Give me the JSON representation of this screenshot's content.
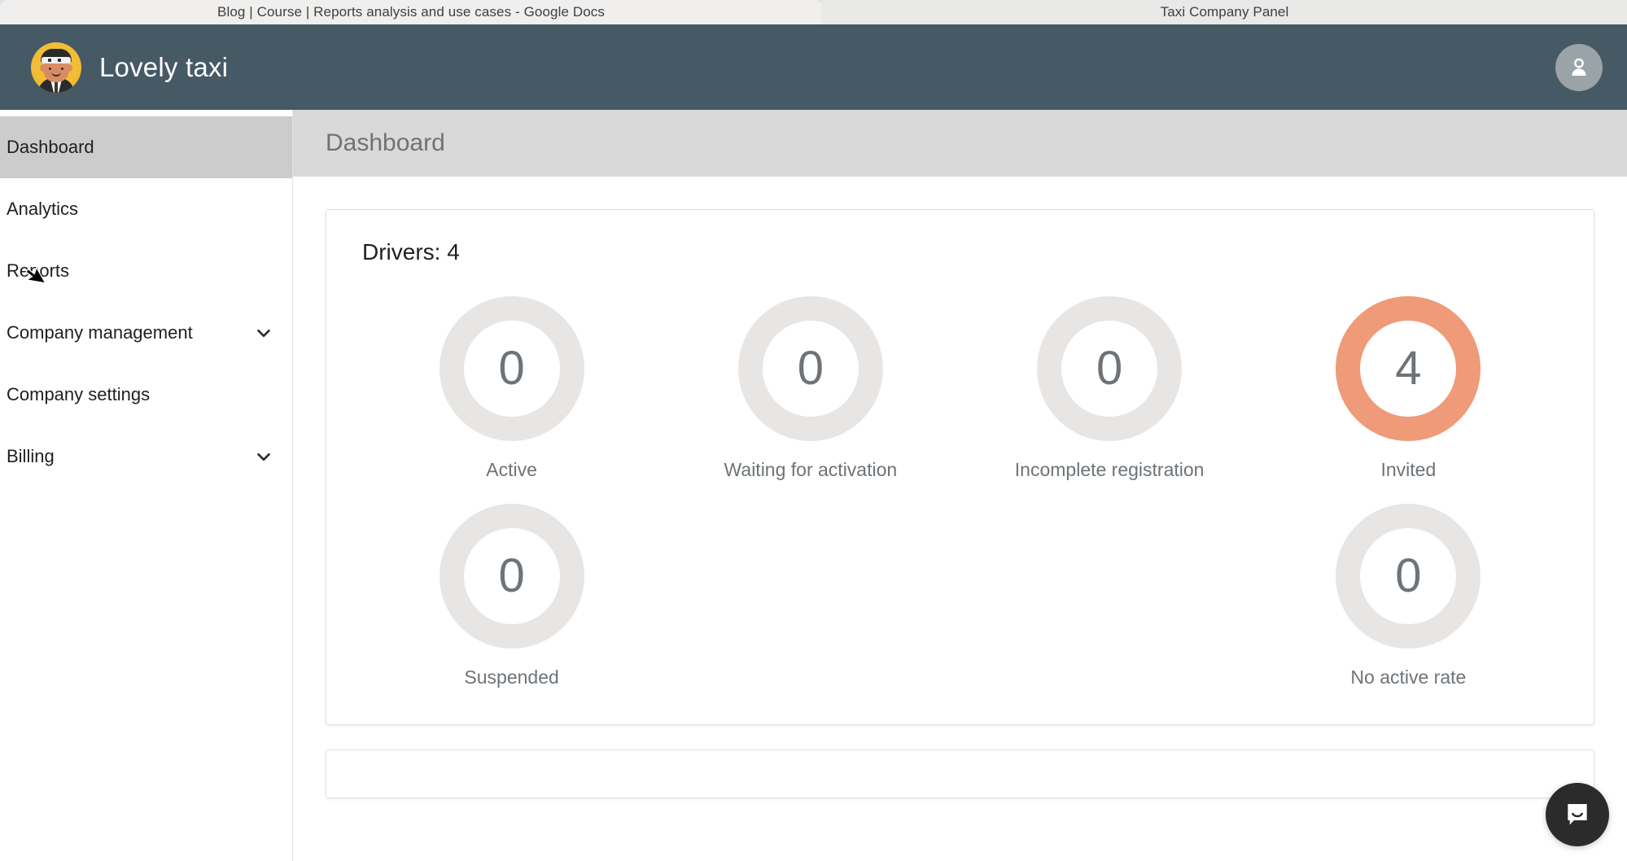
{
  "browser": {
    "tabs": [
      {
        "title": "Blog | Course | Reports analysis and use cases - Google Docs",
        "active": true
      },
      {
        "title": "Taxi Company Panel",
        "active": false
      }
    ]
  },
  "topbar": {
    "logo_icon": "taxi-driver-avatar-icon",
    "brand_name": "Lovely taxi",
    "profile_icon": "person-icon"
  },
  "sidebar": {
    "items": [
      {
        "label": "Dashboard",
        "selected": true,
        "chevron": false
      },
      {
        "label": "Analytics",
        "selected": false,
        "chevron": false
      },
      {
        "label": "Reports",
        "selected": false,
        "chevron": false
      },
      {
        "label": "Company management",
        "selected": false,
        "chevron": true
      },
      {
        "label": "Company settings",
        "selected": false,
        "chevron": false
      },
      {
        "label": "Billing",
        "selected": false,
        "chevron": true
      }
    ],
    "chevron_icon": "chevron-down-icon"
  },
  "page": {
    "title": "Dashboard"
  },
  "drivers_card": {
    "title": "Drivers: 4",
    "stats": [
      {
        "value": "0",
        "label": "Active",
        "color": "#e8e6e4"
      },
      {
        "value": "0",
        "label": "Waiting for activation",
        "color": "#e8e6e4"
      },
      {
        "value": "0",
        "label": "Incomplete registration",
        "color": "#e8e6e4"
      },
      {
        "value": "4",
        "label": "Invited",
        "color": "#ef9a78"
      },
      {
        "value": "0",
        "label": "Suspended",
        "color": "#e8e6e4"
      },
      {
        "value": "",
        "label": "",
        "color": "none"
      },
      {
        "value": "",
        "label": "",
        "color": "none"
      },
      {
        "value": "0",
        "label": "No active rate",
        "color": "#e8e6e4"
      }
    ]
  },
  "widgets": {
    "intercom_icon": "chat-bubble-icon"
  },
  "colors": {
    "topbar": "#455a64",
    "accent": "#ef9a78",
    "ring_muted": "#e8e6e4",
    "selected_nav": "#cccccc",
    "page_header": "#d9d9d9",
    "text_muted": "#6e7377"
  }
}
